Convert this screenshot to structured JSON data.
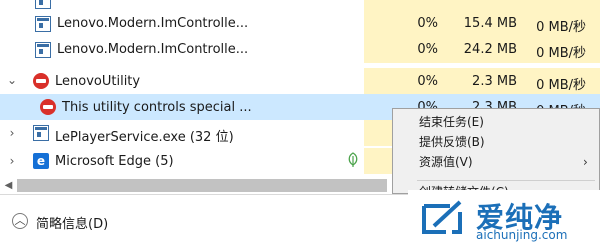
{
  "processes": [
    {
      "name": "Lenovo.Modern.ImControlle...",
      "cpu": "0%",
      "memory": "15.4 MB",
      "disk": "0 MB/秒",
      "icon": "window-process-icon"
    },
    {
      "name": "Lenovo.Modern.ImControlle...",
      "cpu": "0%",
      "memory": "24.2 MB",
      "disk": "0 MB/秒",
      "icon": "window-process-icon"
    },
    {
      "name": "LenovoUtility",
      "cpu": "0%",
      "memory": "2.3 MB",
      "disk": "0 MB/秒",
      "icon": "lenovo-utility-icon",
      "expanded": true
    },
    {
      "name": "This utility controls special ...",
      "cpu": "0%",
      "memory": "2.3 MB",
      "disk": "0 MB/秒",
      "icon": "lenovo-utility-icon",
      "selected": true
    },
    {
      "name": "LePlayerService.exe (32 位)",
      "icon": "window-process-icon",
      "expanded": false
    },
    {
      "name": "Microsoft Edge (5)",
      "icon": "edge-icon",
      "expanded": false,
      "status_icon": "leaf-icon"
    }
  ],
  "context_menu": {
    "items": [
      {
        "label": "结束任务(E)"
      },
      {
        "label": "提供反馈(B)"
      },
      {
        "label": "资源值(V)",
        "submenu": true
      },
      {
        "label": "创建转储文件(C)"
      }
    ]
  },
  "footer": {
    "fewer_details": "简略信息(D)"
  },
  "watermark": {
    "name": "爱纯净",
    "site": "aichunjing.com"
  },
  "colors": {
    "highlight": "#fff4c4",
    "selected": "#cce8ff",
    "menu_bg": "#f0f0f0",
    "watermark": "#1b6fb8"
  }
}
